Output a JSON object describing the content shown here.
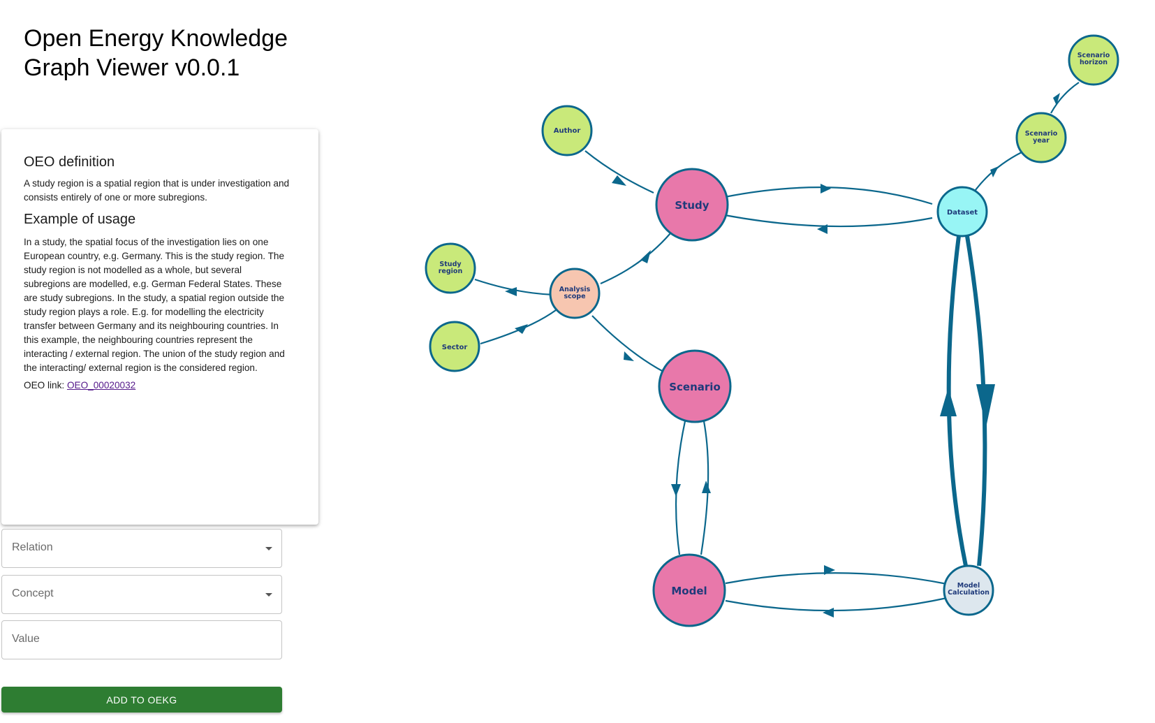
{
  "app": {
    "title": "Open Energy Knowledge Graph Viewer v0.0.1"
  },
  "definition_card": {
    "definition_heading": "OEO definition",
    "definition_text": "A study region is a spatial region that is under investigation and consists entirely of one or more subregions.",
    "usage_heading": "Example of usage",
    "usage_text": "In a study, the spatial focus of the investigation lies on one European country, e.g. Germany. This is the study region. The study region is not modelled as a whole, but several subregions are modelled, e.g. German Federal States. These are study subregions. In the study, a spatial region outside the study region plays a role. E.g. for modelling the electricity transfer between Germany and its neighbouring countries. In this example, the neighbouring countries represent the interacting / external region. The union of the study region and the interacting/ external region is the considered region.",
    "link_prefix": "OEO link: ",
    "link_text": "OEO_00020032"
  },
  "form": {
    "relation_label": "Relation",
    "concept_label": "Concept",
    "value_label": "Value",
    "submit_label": "ADD TO OEKG"
  },
  "graph": {
    "colors": {
      "edge": "#0b678c",
      "pink": "#e878aa",
      "green": "#c9e97a",
      "cyan": "#98f5f5",
      "peach": "#f7c6b0",
      "pale": "#dde7ee",
      "label": "#1f3a7a"
    },
    "nodes": {
      "study": "Study",
      "scenario": "Scenario",
      "model": "Model",
      "author": "Author",
      "study_region": [
        "Study",
        "region"
      ],
      "analysis_scope": [
        "Analysis",
        "scope"
      ],
      "sector": "Sector",
      "dataset": "Dataset",
      "scenario_year": [
        "Scenario",
        "year"
      ],
      "scenario_horizon": [
        "Scenario",
        "horizon"
      ],
      "model_calculation": [
        "Model",
        "Calculation"
      ]
    }
  }
}
